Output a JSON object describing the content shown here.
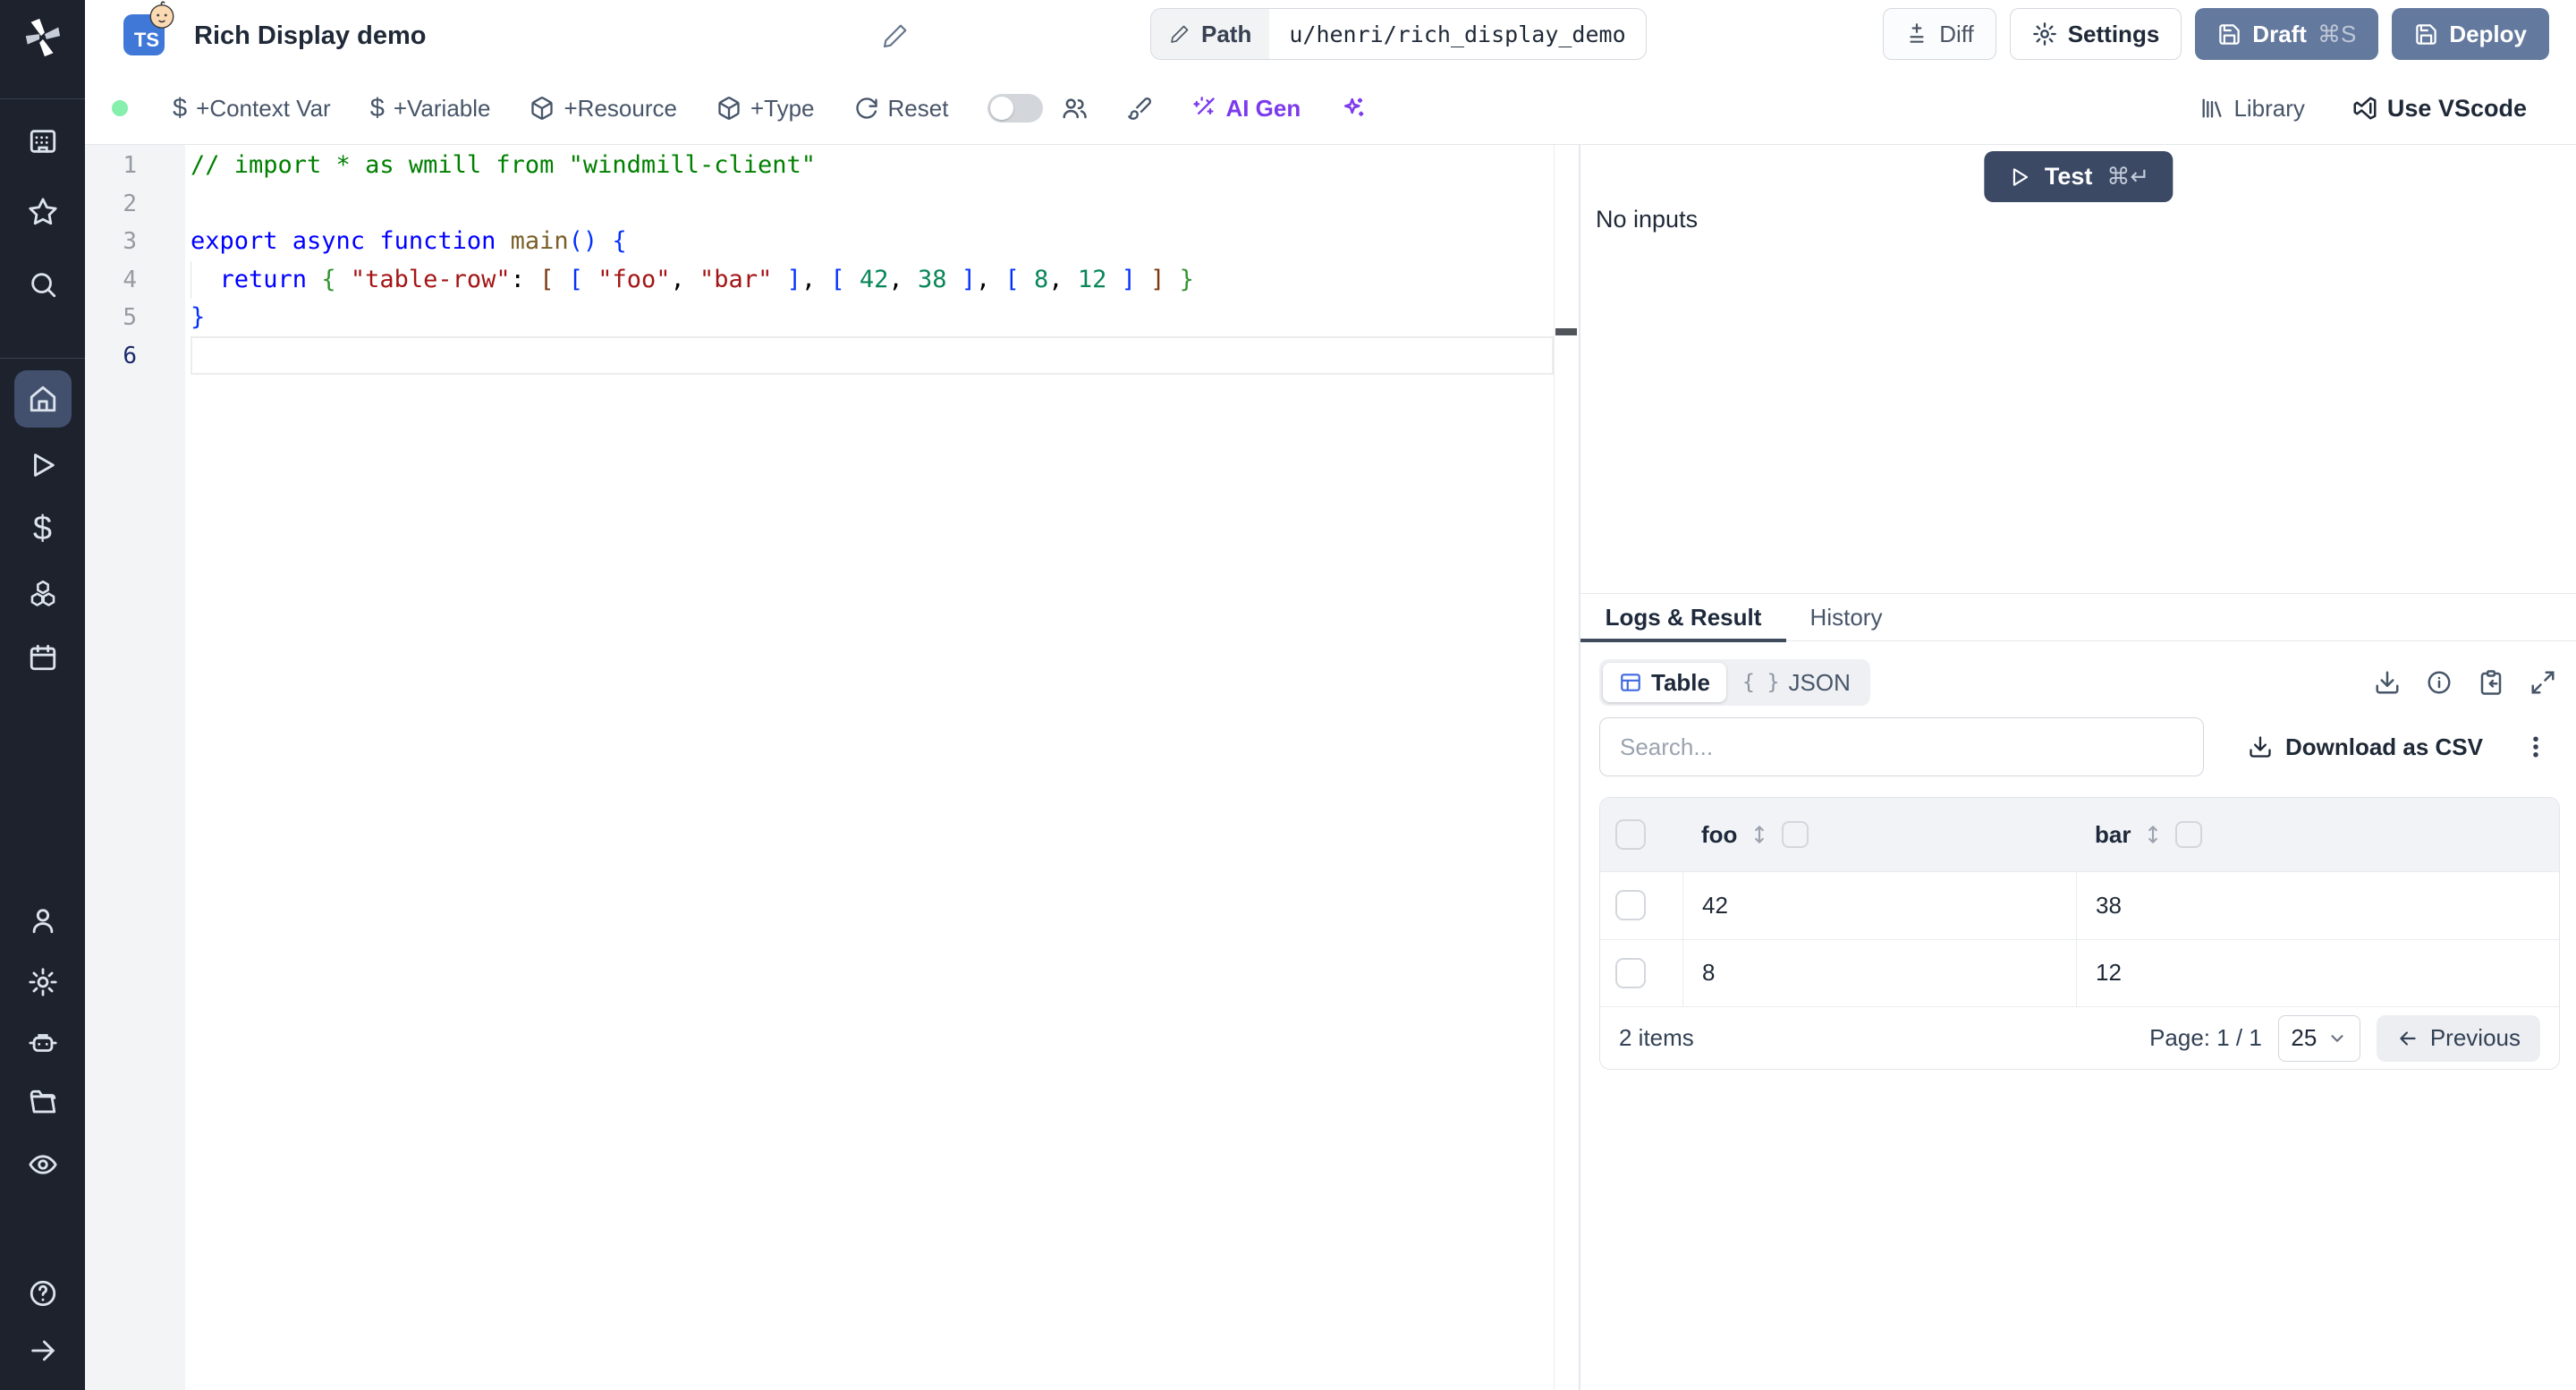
{
  "header": {
    "language_badge": "TS",
    "badge_emoji": "baby-face",
    "title": "Rich Display demo",
    "path_label": "Path",
    "path_value": "u/henri/rich_display_demo",
    "diff_label": "Diff",
    "settings_label": "Settings",
    "draft_label": "Draft",
    "draft_shortcut": "⌘S",
    "deploy_label": "Deploy"
  },
  "toolbar": {
    "context_var_label": "+Context Var",
    "variable_label": "+Variable",
    "resource_label": "+Resource",
    "type_label": "+Type",
    "reset_label": "Reset",
    "ai_gen_label": "AI Gen",
    "library_label": "Library",
    "vscode_label": "Use VScode",
    "dollar_glyph": "$",
    "status_color": "#86efac",
    "ai_accent": "#7c3aed"
  },
  "sidebar_icons": [
    "windmill-logo",
    "workspace-icon",
    "star-icon",
    "search-icon",
    "home-icon",
    "runs-icon",
    "variables-icon",
    "resources-icon",
    "schedules-icon",
    "user-icon",
    "settings-icon",
    "workers-icon",
    "folders-icon",
    "audit-icon",
    "help-icon",
    "collapse-icon"
  ],
  "editor": {
    "token_colors": {
      "comment": "#008000",
      "keyword": "#0000ff",
      "string": "#a31515",
      "number": "#098658",
      "function": "#795e26",
      "plain": "#000000",
      "bracket1": "#0431fa",
      "bracket2": "#319331",
      "bracket3": "#7b3814"
    },
    "lines": [
      {
        "num": "1",
        "tokens": [
          [
            "// import * as wmill from \"windmill-client\"",
            "comment"
          ]
        ]
      },
      {
        "num": "2",
        "tokens": []
      },
      {
        "num": "3",
        "tokens": [
          [
            "export async function ",
            "keyword"
          ],
          [
            "main",
            "function"
          ],
          [
            "()",
            "bracket1"
          ],
          [
            " ",
            "plain"
          ],
          [
            "{",
            "bracket1"
          ]
        ]
      },
      {
        "num": "4",
        "tokens": [
          [
            "  ",
            "plain"
          ],
          [
            "return",
            "keyword"
          ],
          [
            " ",
            "plain"
          ],
          [
            "{",
            "bracket2"
          ],
          [
            " ",
            "plain"
          ],
          [
            "\"table-row\"",
            "string"
          ],
          [
            ": ",
            "plain"
          ],
          [
            "[",
            "bracket3"
          ],
          [
            " ",
            "plain"
          ],
          [
            "[",
            "bracket1"
          ],
          [
            " ",
            "plain"
          ],
          [
            "\"foo\"",
            "string"
          ],
          [
            ", ",
            "plain"
          ],
          [
            "\"bar\"",
            "string"
          ],
          [
            " ",
            "plain"
          ],
          [
            "]",
            "bracket1"
          ],
          [
            ", ",
            "plain"
          ],
          [
            "[",
            "bracket1"
          ],
          [
            " ",
            "plain"
          ],
          [
            "42",
            "number"
          ],
          [
            ", ",
            "plain"
          ],
          [
            "38",
            "number"
          ],
          [
            " ",
            "plain"
          ],
          [
            "]",
            "bracket1"
          ],
          [
            ", ",
            "plain"
          ],
          [
            "[",
            "bracket1"
          ],
          [
            " ",
            "plain"
          ],
          [
            "8",
            "number"
          ],
          [
            ", ",
            "plain"
          ],
          [
            "12",
            "number"
          ],
          [
            " ",
            "plain"
          ],
          [
            "]",
            "bracket1"
          ],
          [
            " ",
            "plain"
          ],
          [
            "]",
            "bracket3"
          ],
          [
            " ",
            "plain"
          ],
          [
            "}",
            "bracket2"
          ]
        ]
      },
      {
        "num": "5",
        "tokens": [
          [
            "}",
            "bracket1"
          ]
        ]
      },
      {
        "num": "6",
        "tokens": [],
        "current": true
      }
    ]
  },
  "run_panel": {
    "test_label": "Test",
    "test_shortcut": "⌘↵",
    "no_inputs": "No inputs"
  },
  "result_panel": {
    "tabs": [
      {
        "label": "Logs & Result",
        "active": true
      },
      {
        "label": "History",
        "active": false
      }
    ],
    "view_modes": [
      {
        "label": "Table",
        "active": true
      },
      {
        "label": "JSON",
        "active": false
      }
    ],
    "json_glyph": "{ }",
    "toolbar_icons": [
      "download-icon",
      "info-icon",
      "clipboard-import-icon",
      "expand-icon"
    ],
    "search_placeholder": "Search...",
    "download_csv_label": "Download as CSV",
    "table": {
      "columns": [
        "foo",
        "bar"
      ],
      "rows": [
        [
          "42",
          "38"
        ],
        [
          "8",
          "12"
        ]
      ]
    },
    "footer": {
      "items_count": "2 items",
      "page_label": "Page: 1 / 1",
      "page_size": "25",
      "previous_label": "Previous"
    }
  },
  "colors": {
    "sidebar_bg": "#1d222d",
    "sidebar_active": "#42506e",
    "primary_button": "#64799e",
    "test_button": "#3b4965",
    "table_icon_blue": "#4069e1"
  }
}
